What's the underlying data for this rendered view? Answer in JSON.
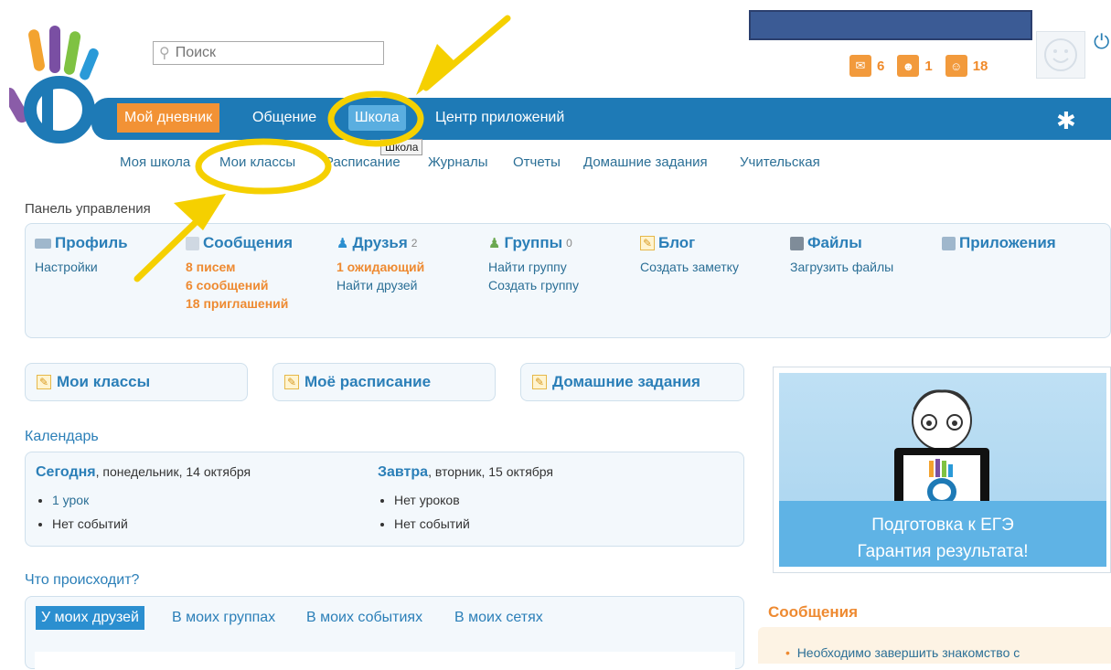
{
  "header": {
    "search_placeholder": "Поиск",
    "notifications": [
      {
        "icon": "envelope-icon",
        "count": "6"
      },
      {
        "icon": "person-icon",
        "count": "1"
      },
      {
        "icon": "group-icon",
        "count": "18"
      }
    ]
  },
  "nav": {
    "items": [
      "Мой дневник",
      "Общение",
      "Школа",
      "Центр приложений"
    ],
    "tooltip": "Школа"
  },
  "subnav": [
    "Моя школа",
    "Мои классы",
    "Расписание",
    "Журналы",
    "Отчеты",
    "Домашние задания",
    "Учительская"
  ],
  "panel": {
    "title": "Панель управления",
    "profile": {
      "title": "Профиль",
      "links": [
        "Настройки"
      ]
    },
    "messages": {
      "title": "Сообщения",
      "links": [
        "8 писем",
        "6 сообщений",
        "18 приглашений"
      ]
    },
    "friends": {
      "title": "Друзья",
      "count": "2",
      "links": [
        "1 ожидающий",
        "Найти друзей"
      ]
    },
    "groups": {
      "title": "Группы",
      "count": "0",
      "links": [
        "Найти группу",
        "Создать группу"
      ]
    },
    "blog": {
      "title": "Блог",
      "links": [
        "Создать заметку"
      ]
    },
    "files": {
      "title": "Файлы",
      "links": [
        "Загрузить файлы"
      ]
    },
    "apps": {
      "title": "Приложения"
    }
  },
  "buttons": [
    "Мои классы",
    "Моё расписание",
    "Домашние задания"
  ],
  "calendar": {
    "title": "Календарь",
    "today_label": "Сегодня",
    "today_date": ", понедельник, 14 октября",
    "today_items": [
      "1 урок",
      "Нет событий"
    ],
    "tomorrow_label": "Завтра",
    "tomorrow_date": ", вторник, 15 октября",
    "tomorrow_items": [
      "Нет уроков",
      "Нет событий"
    ]
  },
  "feed": {
    "title": "Что происходит?",
    "tabs": [
      "У моих друзей",
      "В моих группах",
      "В моих событиях",
      "В моих сетях"
    ]
  },
  "ad": {
    "line1": "Подготовка к ЕГЭ",
    "line2": "Гарантия результата!"
  },
  "messages_sidebar": {
    "title": "Сообщения",
    "item": "Необходимо завершить знакомство с"
  },
  "colors": {
    "nav": "#1e7ab6",
    "accent": "#f29235",
    "annotation": "#f5d000"
  }
}
